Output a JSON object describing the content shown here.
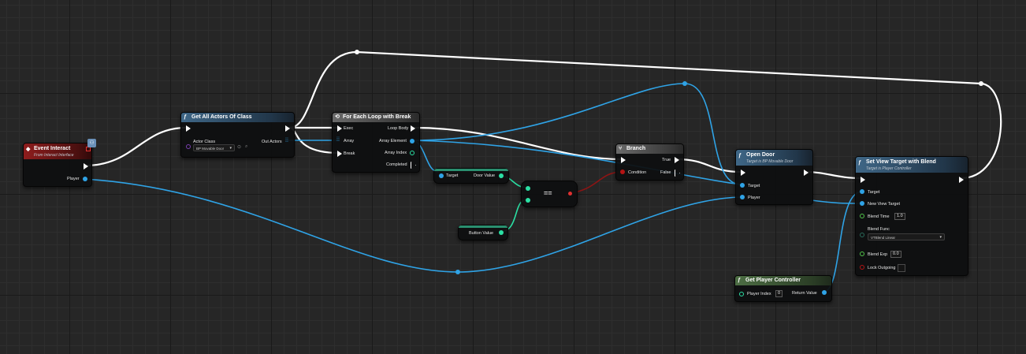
{
  "nodes": {
    "event_interact": {
      "title": "Event Interact",
      "subtitle": "From Interact Interface",
      "pin_player": "Player"
    },
    "get_all_actors": {
      "title": "Get All Actors Of Class",
      "pin_actor_class": "Actor Class",
      "actor_class_value": "BP Movable Door",
      "pin_out_actors": "Out Actors"
    },
    "for_each": {
      "title": "For Each Loop with Break",
      "pin_exec": "Exec",
      "pin_array": "Array",
      "pin_break": "Break",
      "pin_loop_body": "Loop Body",
      "pin_array_element": "Array Element",
      "pin_array_index": "Array Index",
      "pin_completed": "Completed"
    },
    "door_value": {
      "pin_target": "Target",
      "pin_door_value": "Door Value"
    },
    "button_value": {
      "pin_button_value": "Button Value"
    },
    "equal": {
      "symbol": "=="
    },
    "branch": {
      "title": "Branch",
      "pin_condition": "Condition",
      "pin_true": "True",
      "pin_false": "False"
    },
    "open_door": {
      "title": "Open Door",
      "subtitle": "Target is BP Movable Door",
      "pin_target": "Target",
      "pin_player": "Player"
    },
    "set_view_target": {
      "title": "Set View Target with Blend",
      "subtitle": "Target is Player Controller",
      "pin_target": "Target",
      "pin_new_view_target": "New View Target",
      "pin_blend_time": "Blend Time",
      "blend_time_value": "1.0",
      "pin_blend_func": "Blend Func",
      "blend_func_value": "VTBlend Linear",
      "pin_blend_exp": "Blend Exp",
      "blend_exp_value": "0.0",
      "pin_lock_outgoing": "Lock Outgoing"
    },
    "get_player_controller": {
      "title": "Get Player Controller",
      "pin_player_index": "Player Index",
      "player_index_value": "0",
      "pin_return_value": "Return Value"
    }
  },
  "colors": {
    "exec": "#ffffff",
    "object": "#2fa3e6",
    "boolean": "#b31414",
    "integer": "#2be0a4",
    "float": "#52c44a"
  }
}
